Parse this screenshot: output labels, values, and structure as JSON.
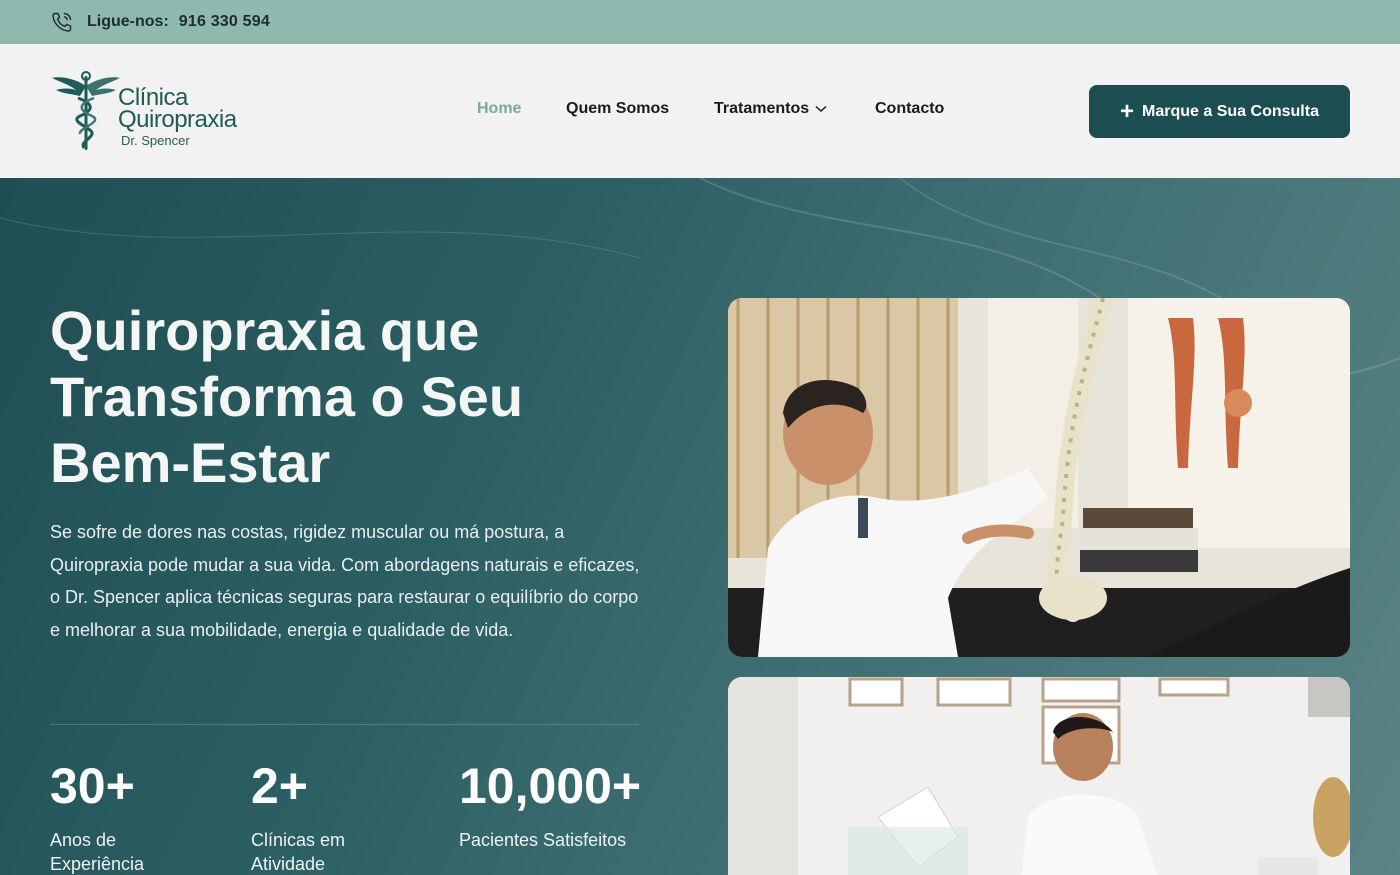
{
  "topbar": {
    "phone_icon": "phone-icon",
    "label": "Ligue-nos:",
    "number": "916 330 594"
  },
  "logo": {
    "line1": "Clínica",
    "line2": "Quiropraxia",
    "line3": "Dr. Spencer"
  },
  "nav": {
    "items": [
      {
        "label": "Home",
        "active": true
      },
      {
        "label": "Quem Somos"
      },
      {
        "label": "Tratamentos",
        "has_dropdown": true
      },
      {
        "label": "Contacto"
      }
    ]
  },
  "cta": {
    "label": "Marque a Sua Consulta",
    "icon": "plus-icon"
  },
  "hero": {
    "title": "Quiropraxia que Transforma o Seu Bem-Estar",
    "description": "Se sofre de dores nas costas, rigidez muscular ou má postura, a Quiropraxia pode mudar a sua vida. Com abordagens naturais e eficazes, o Dr. Spencer aplica técnicas seguras para restaurar o equilíbrio do corpo e melhorar a sua mobilidade, energia e qualidade de vida.",
    "stats": [
      {
        "value": "30+",
        "caption": "Anos de Experiência"
      },
      {
        "value": "2+",
        "caption": "Clínicas em Atividade"
      },
      {
        "value": "10,000+",
        "caption": "Pacientes Satisfeitos"
      }
    ]
  },
  "colors": {
    "topbar": "#8fb8ae",
    "header_bg": "#f2f2f2",
    "accent": "#1c4d51",
    "active_nav": "#7fa8a2",
    "hero_start": "#1f4e53",
    "hero_end": "#5a8384"
  }
}
